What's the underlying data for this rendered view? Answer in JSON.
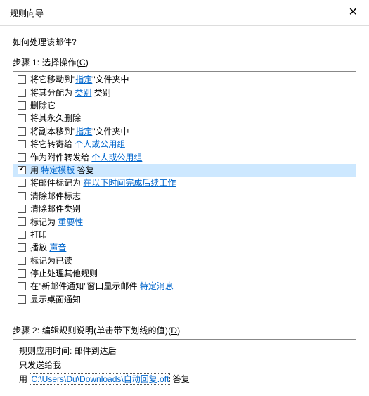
{
  "titlebar": {
    "title": "规则向导"
  },
  "question": "如何处理该邮件?",
  "step1": {
    "label_prefix": "步骤 1: 选择操作(",
    "accel": "C",
    "label_suffix": ")",
    "items": [
      {
        "pre": "将它移动到\"",
        "link": "指定",
        "post": "\"文件夹中",
        "checked": false
      },
      {
        "pre": "将其分配为 ",
        "link": "类别",
        "post": " 类别",
        "checked": false
      },
      {
        "pre": "删除它",
        "checked": false
      },
      {
        "pre": "将其永久删除",
        "checked": false
      },
      {
        "pre": "将副本移到\"",
        "link": "指定",
        "post": "\"文件夹中",
        "checked": false
      },
      {
        "pre": "将它转寄给 ",
        "link": "个人或公用组",
        "post": "",
        "checked": false
      },
      {
        "pre": "作为附件转发给 ",
        "link": "个人或公用组",
        "post": "",
        "checked": false
      },
      {
        "pre": "用 ",
        "link": "特定模板",
        "post": " 答复",
        "checked": true,
        "selected": true
      },
      {
        "pre": "将邮件标记为 ",
        "link": "在以下时间完成后续工作",
        "post": "",
        "checked": false
      },
      {
        "pre": "清除邮件标志",
        "checked": false
      },
      {
        "pre": "清除邮件类别",
        "checked": false
      },
      {
        "pre": "标记为 ",
        "link": "重要性",
        "post": "",
        "checked": false
      },
      {
        "pre": "打印",
        "checked": false
      },
      {
        "pre": "播放 ",
        "link": "声音",
        "post": "",
        "checked": false
      },
      {
        "pre": "标记为已读",
        "checked": false
      },
      {
        "pre": "停止处理其他规则",
        "checked": false
      },
      {
        "pre": "在\"新邮件通知\"窗口显示邮件 ",
        "link": "特定消息",
        "post": "",
        "checked": false
      },
      {
        "pre": "显示桌面通知",
        "checked": false
      }
    ]
  },
  "step2": {
    "label_prefix": "步骤 2: 编辑规则说明(单击带下划线的值)(",
    "accel": "D",
    "label_suffix": ")",
    "line1": "规则应用时间: 邮件到达后",
    "line2": "只发送给我",
    "line3_pre": "用 ",
    "line3_link": "C:\\Users\\Du\\Downloads\\自动回复.oft",
    "line3_post": " 答复"
  }
}
